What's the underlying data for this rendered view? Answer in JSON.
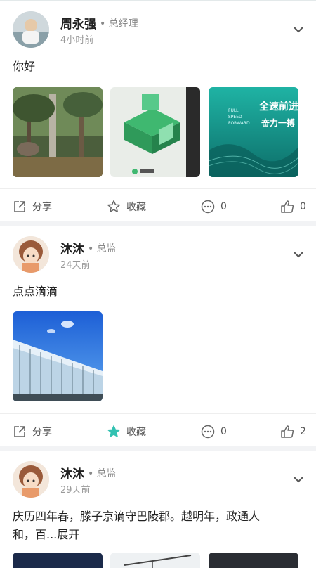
{
  "posts": [
    {
      "author": "周永强",
      "role": "总经理",
      "time": "4小时前",
      "text": "你好",
      "image_labels": [
        "FULL",
        "SPEED",
        "FORWARD",
        "全速前进",
        "奋力一搏"
      ],
      "actions": {
        "share": "分享",
        "favorite": "收藏",
        "comments": "0",
        "likes": "0"
      },
      "favorited": false
    },
    {
      "author": "沐沐",
      "role": "总监",
      "time": "24天前",
      "text": "点点滴滴",
      "actions": {
        "share": "分享",
        "favorite": "收藏",
        "comments": "0",
        "likes": "2"
      },
      "favorited": true
    },
    {
      "author": "沐沐",
      "role": "总监",
      "time": "29天前",
      "text_line1": "庆历四年春，滕子京谪守巴陵郡。越明年，政通人",
      "text_line2": "和，百...展开"
    }
  ],
  "colors": {
    "accent": "#33c2b2",
    "muted": "#999999",
    "text": "#222222"
  }
}
